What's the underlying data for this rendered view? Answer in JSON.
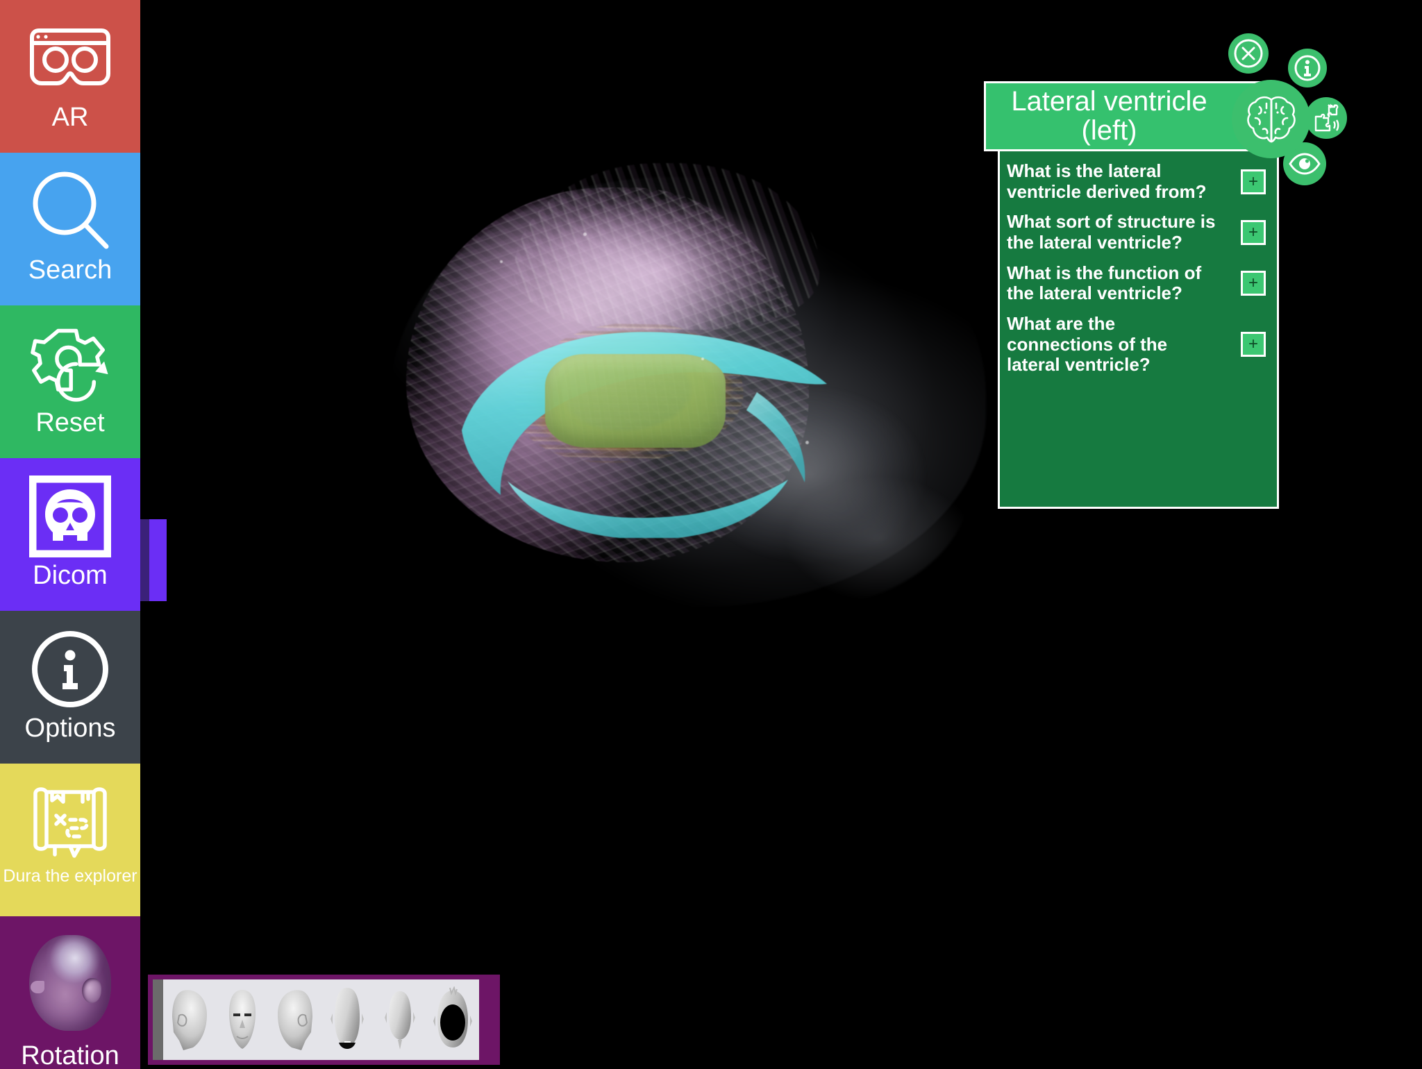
{
  "app": {
    "background_color": "#000000",
    "accent_green": "#3cbf6d",
    "panel_green_dark": "#167a40",
    "panel_green_light": "#35c16e"
  },
  "sidebar": {
    "items": [
      {
        "label": "AR",
        "icon": "vr-headset-icon",
        "color": "#cc5149",
        "text_size": "normal"
      },
      {
        "label": "Search",
        "icon": "magnifier-icon",
        "color": "#47a3ef",
        "text_size": "normal"
      },
      {
        "label": "Reset",
        "icon": "gear-reset-icon",
        "color": "#2fb862",
        "text_size": "normal"
      },
      {
        "label": "Dicom",
        "icon": "skull-icon",
        "color": "#6b2ef5",
        "text_size": "normal"
      },
      {
        "label": "Options",
        "icon": "info-circle-icon",
        "color": "#3c434a",
        "text_size": "normal"
      },
      {
        "label": "Dura the explorer",
        "icon": "treasure-map-icon",
        "color": "#e4d95a",
        "text_size": "small"
      },
      {
        "label": "Rotation",
        "icon": "head-3d-icon",
        "color": "#6d1566",
        "text_size": "normal"
      }
    ],
    "active_item": "Dicom",
    "active_tab_color": "#6b2ef5"
  },
  "info_panel": {
    "title": "Lateral ventricle (left)",
    "title_line_1": "Lateral ventricle",
    "title_line_2": "(left)",
    "header_icon": "brain-icon",
    "questions": [
      {
        "text": "What is the lateral ventricle derived from?",
        "expand_label": "+"
      },
      {
        "text": "What sort of structure is the lateral ventricle?",
        "expand_label": "+"
      },
      {
        "text": "What is the function of the lateral ventricle?",
        "expand_label": "+"
      },
      {
        "text": "What are the connections of the lateral ventricle?",
        "expand_label": "+"
      }
    ]
  },
  "action_buttons": [
    {
      "name": "close",
      "icon": "close-circle-icon"
    },
    {
      "name": "info",
      "icon": "info-circle-icon"
    },
    {
      "name": "brain",
      "icon": "brain-icon"
    },
    {
      "name": "puzzle",
      "icon": "puzzle-piece-icon"
    },
    {
      "name": "eye",
      "icon": "eye-icon"
    }
  ],
  "thumbnail_strip": {
    "background_color": "#6d1566",
    "panel_color": "#e4e4e9",
    "views": [
      {
        "name": "left-lateral-view"
      },
      {
        "name": "anterior-view"
      },
      {
        "name": "right-lateral-view"
      },
      {
        "name": "superior-view"
      },
      {
        "name": "inferior-view"
      },
      {
        "name": "axial-slice-view"
      }
    ]
  },
  "viewport": {
    "model": "3D brain volumetric render",
    "highlighted_structure": "Lateral ventricle (left)",
    "structure_colors": {
      "cortex": "#c892c6",
      "lateral_ventricle": "#66e0e2",
      "corpus_callosum": "#c4963a",
      "thalamus": "#9cbc6a",
      "shell": "#c8ccd8"
    }
  }
}
